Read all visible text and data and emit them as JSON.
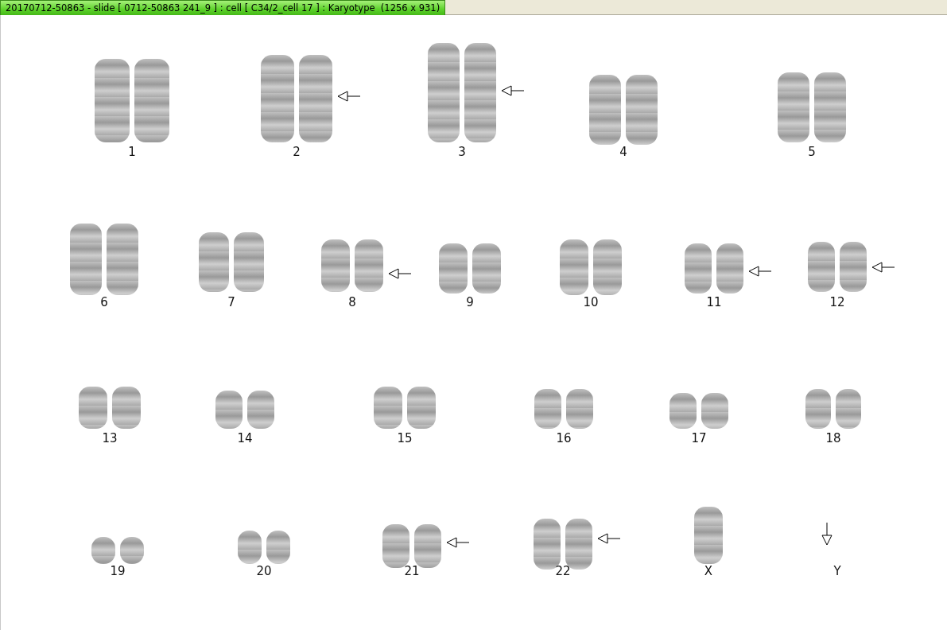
{
  "window": {
    "title": "20170712-50863 - slide [ 0712-50863 241_9 ] : cell [ C34/2_cell 17 ] : Karyotype  (1256 x 931)"
  },
  "karyotype": [
    {
      "label": "1",
      "kind": "pair",
      "marked": false
    },
    {
      "label": "2",
      "kind": "pair",
      "marked": true
    },
    {
      "label": "3",
      "kind": "pair",
      "marked": true
    },
    {
      "label": "4",
      "kind": "pair",
      "marked": false
    },
    {
      "label": "5",
      "kind": "pair",
      "marked": false
    },
    {
      "label": "6",
      "kind": "pair",
      "marked": false
    },
    {
      "label": "7",
      "kind": "pair",
      "marked": false
    },
    {
      "label": "8",
      "kind": "pair",
      "marked": true
    },
    {
      "label": "9",
      "kind": "pair",
      "marked": false
    },
    {
      "label": "10",
      "kind": "pair",
      "marked": false
    },
    {
      "label": "11",
      "kind": "pair",
      "marked": true
    },
    {
      "label": "12",
      "kind": "pair",
      "marked": true
    },
    {
      "label": "13",
      "kind": "pair",
      "marked": false
    },
    {
      "label": "14",
      "kind": "pair",
      "marked": false
    },
    {
      "label": "15",
      "kind": "pair",
      "marked": false
    },
    {
      "label": "16",
      "kind": "pair",
      "marked": false
    },
    {
      "label": "17",
      "kind": "pair",
      "marked": false
    },
    {
      "label": "18",
      "kind": "pair",
      "marked": false
    },
    {
      "label": "19",
      "kind": "pair",
      "marked": false
    },
    {
      "label": "20",
      "kind": "pair",
      "marked": false
    },
    {
      "label": "21",
      "kind": "pair",
      "marked": true
    },
    {
      "label": "22",
      "kind": "pair",
      "marked": true
    },
    {
      "label": "X",
      "kind": "single",
      "marked": false
    },
    {
      "label": "Y",
      "kind": "empty",
      "marked": true
    }
  ]
}
